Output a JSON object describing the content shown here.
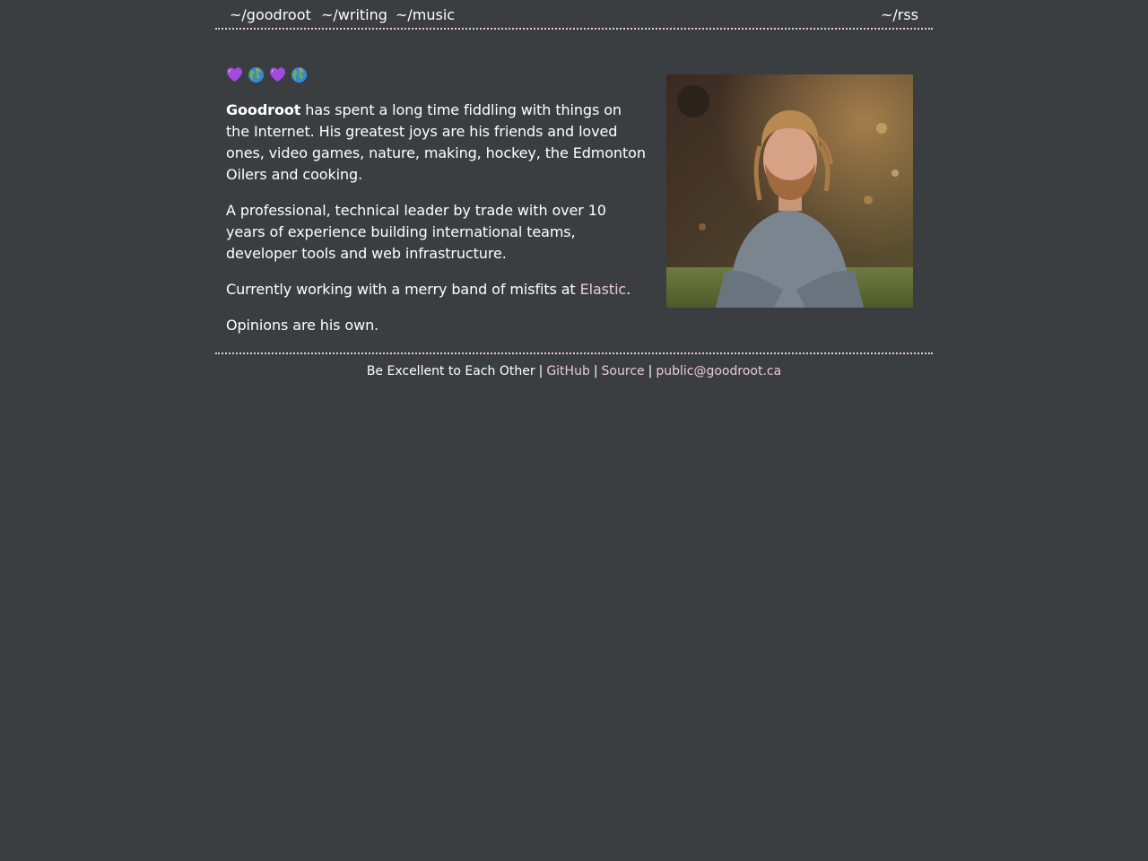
{
  "nav": {
    "home": "~/goodroot",
    "writing": "~/writing",
    "music": "~/music",
    "rss": "~/rss"
  },
  "emojis": [
    "purple-heart-icon",
    "earth-globe-icon",
    "purple-heart-icon",
    "earth-globe-icon"
  ],
  "intro": {
    "name": "Goodroot",
    "bio": " has spent a long time fiddling with things on the Internet. His greatest joys are his friends and loved ones, video games, nature, making, hockey, the Edmonton Oilers and cooking.",
    "professional": "A professional, technical leader by trade with over 10 years of experience building international teams, developer tools and web infrastructure.",
    "current_prefix": "Currently working with a merry band of misfits at ",
    "current_link": "Elastic",
    "current_suffix": ".",
    "opinions": "Opinions are his own."
  },
  "footer": {
    "motto": "Be Excellent to Each Other",
    "sep": "|",
    "github": "GitHub",
    "source": "Source",
    "email": "public@goodroot.ca"
  },
  "colors": {
    "background": "#3a3e41",
    "text": "#ffffff",
    "accent": "#e8c9d7"
  }
}
